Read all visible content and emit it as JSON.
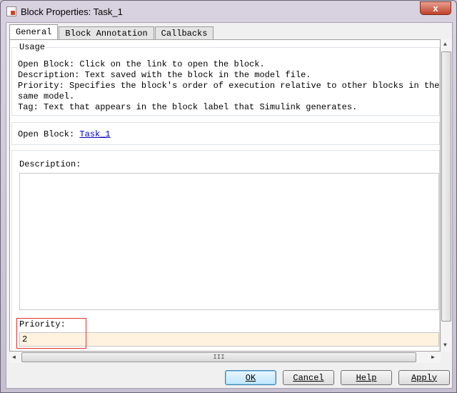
{
  "window": {
    "title": "Block Properties: Task_1",
    "close_label": "x"
  },
  "tabs": [
    {
      "label": "General",
      "active": true
    },
    {
      "label": "Block Annotation"
    },
    {
      "label": "Callbacks"
    }
  ],
  "usage": {
    "legend": "Usage",
    "lines": [
      "Open Block: Click on the link to open the block.",
      "Description: Text saved with the block in the model file.",
      "Priority: Specifies the block's order of execution relative to other blocks in the same model.",
      "Tag: Text that appears in the block label that Simulink generates."
    ]
  },
  "open_block": {
    "label": "Open Block:",
    "link": "Task_1"
  },
  "description": {
    "label": "Description:",
    "value": ""
  },
  "priority": {
    "label": "Priority:",
    "value": "2"
  },
  "hscroll_grip": "III",
  "buttons": {
    "ok": "OK",
    "cancel": "Cancel",
    "help": "Help",
    "apply": "Apply"
  }
}
